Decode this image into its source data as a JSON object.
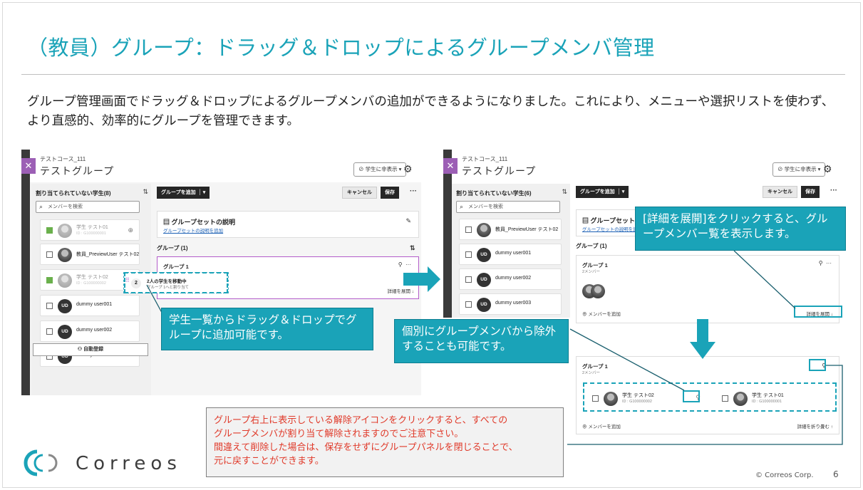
{
  "slide": {
    "title": "（教員）グループ：ドラッグ＆ドロップによるグループメンバ管理",
    "intro": "グループ管理画面でドラッグ＆ドロップによるグループメンバの追加ができるようになりました。これにより、メニューや選択リストを使わず、より直感的、効率的にグループを管理できます。",
    "callout_drag": "学生一覧からドラッグ＆ドロップでグループに追加可能です。",
    "callout_remove": "個別にグループメンバから除外することも可能です。",
    "callout_expand": "[詳細を展開]をクリックすると、グループメンバー覧を表示します。",
    "warning": [
      "グループ右上に表示している解除アイコンをクリックすると、すべての",
      "グループメンバが割り当て解除されますのでご注意下さい。",
      "間違えて削除した場合は、保存をせずにグループパネルを閉じることで、",
      "元に戻すことができます。"
    ],
    "logo_text": "Correos",
    "copyright": "© Correos Corp.",
    "page_number": "6",
    "accent_color": "#1aa3b8",
    "warning_color": "#e03a2a"
  },
  "left_shot": {
    "close_icon": "close-icon",
    "course": "テストコース_111",
    "group_title": "テストグループ",
    "visibility": "学生に非表示",
    "unassigned_title": "割り当てられていない学生(8)",
    "search_placeholder": "メンバーを検索",
    "students": [
      {
        "name": "学生 テスト01",
        "id": "ID : G100000001",
        "checked": true,
        "avatar": "",
        "faded": true
      },
      {
        "name": "教員_PreviewUser テスト02",
        "id": "",
        "checked": false,
        "avatar": "",
        "faded": false
      },
      {
        "name": "学生 テスト02",
        "id": "ID : G100000002",
        "checked": true,
        "avatar": "",
        "faded": true
      },
      {
        "name": "dummy user001",
        "id": "",
        "checked": false,
        "avatar": "UD",
        "faded": false
      },
      {
        "name": "dummy user002",
        "id": "",
        "checked": false,
        "avatar": "UD",
        "faded": false
      },
      {
        "name": "dummy user003",
        "id": "",
        "checked": false,
        "avatar": "UD",
        "faded": false
      }
    ],
    "auto_assign": "自動登録",
    "add_group_btn": "グループを追加",
    "cancel_btn": "キャンセル",
    "save_btn": "保存",
    "groupset_title": "グループセットの説明",
    "groupset_link": "グループセットの説明を追加",
    "groups_label": "グループ (1)",
    "group1_name": "グループ 1",
    "expand_label": "詳細を展開",
    "drag_count": "2",
    "drag_title": "2人の学生を移動中",
    "drag_sub": "グループ 1へと割り当て"
  },
  "right_shot": {
    "course": "テストコース_111",
    "group_title": "テストグループ",
    "visibility": "学生に非表示",
    "unassigned_title": "割り当てられていない学生(6)",
    "search_placeholder": "メンバーを検索",
    "students": [
      {
        "name": "教員_PreviewUser テスト02",
        "avatar": ""
      },
      {
        "name": "dummy user001",
        "avatar": "UD"
      },
      {
        "name": "dummy user002",
        "avatar": "UD"
      },
      {
        "name": "dummy user003",
        "avatar": "UD"
      }
    ],
    "add_group_btn": "グループを追加",
    "cancel_btn": "キャンセル",
    "save_btn": "保存",
    "groupset_title": "グループセットの",
    "groupset_link": "グループセットの説明を追加",
    "groups_label": "グループ (1)",
    "group1_name": "グループ 1",
    "group1_count": "2メンバー",
    "add_member": "メンバーを追加",
    "expand_label": "詳細を展開",
    "collapse_label": "詳細を折り畳む",
    "members": [
      {
        "name": "学生 テスト02",
        "id": "ID : G100000002"
      },
      {
        "name": "学生 テスト01",
        "id": "ID : G100000001"
      }
    ]
  }
}
